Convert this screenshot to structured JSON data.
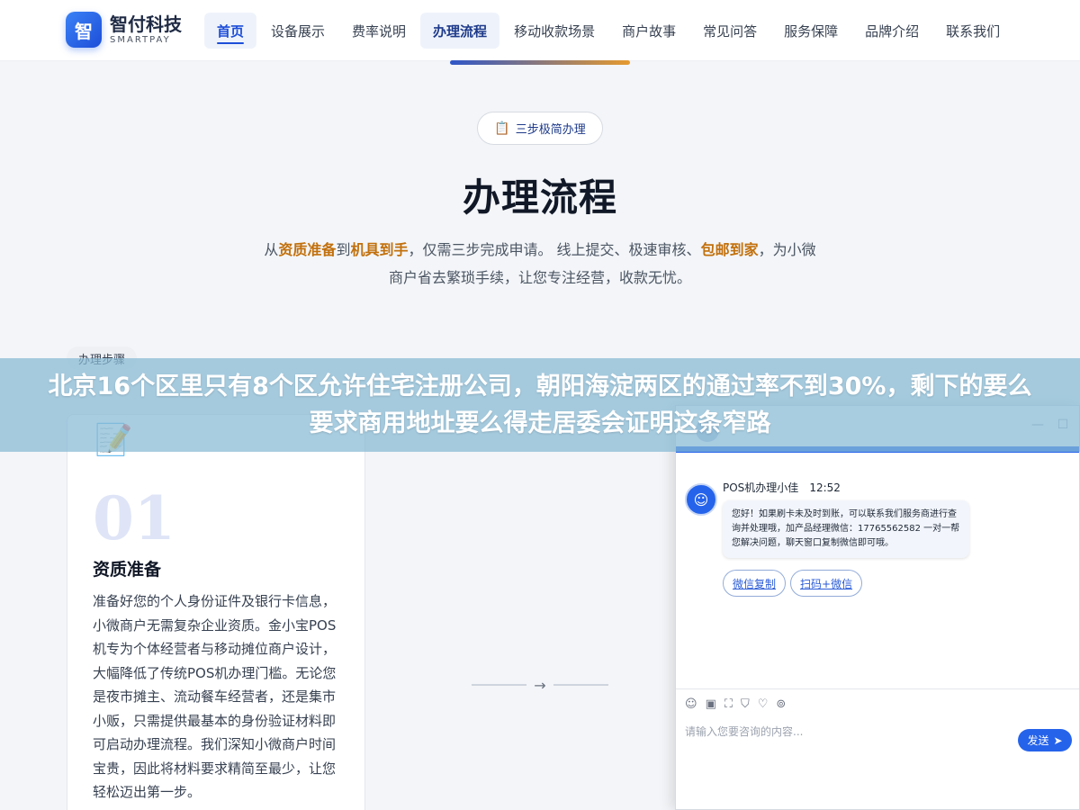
{
  "brand": {
    "mark": "智",
    "name_cn": "智付科技",
    "name_en": "SMARTPAY"
  },
  "nav": [
    {
      "label": "首页"
    },
    {
      "label": "设备展示"
    },
    {
      "label": "费率说明"
    },
    {
      "label": "办理流程"
    },
    {
      "label": "移动收款场景"
    },
    {
      "label": "商户故事"
    },
    {
      "label": "常见问答"
    },
    {
      "label": "服务保障"
    },
    {
      "label": "品牌介绍"
    },
    {
      "label": "联系我们"
    }
  ],
  "hero": {
    "badge_icon": "clipboard-icon",
    "badge": "三步极简办理",
    "title": "办理流程",
    "desc_1": "从",
    "hl_1": "资质准备",
    "desc_2": "到",
    "hl_2": "机具到手",
    "desc_3": "，仅需三步完成申请。 线上提交、极速审核、",
    "hl_3": "包邮到家",
    "desc_4": "，为小微商户省去繁琐手续，让您专注经营，收款无忧。"
  },
  "steps": {
    "tag": "办理步骤",
    "card": {
      "icon": "document-sign-icon",
      "number": "01",
      "title": "资质准备",
      "desc": "准备好您的个人身份证件及银行卡信息，小微商户无需复杂企业资质。金小宝POS机专为个体经营者与移动摊位商户设计，大幅降低了传统POS机办理门槛。无论您是夜市摊主、流动餐车经营者，还是集市小贩，只需提供最基本的身份验证材料即可启动办理流程。我们深知小微商户时间宝贵，因此将材料要求精简至最少，让您轻松迈出第一步。"
    },
    "arrow": "→"
  },
  "banner": {
    "text": "北京16个区里只有8个区允许住宅注册公司，朝阳海淀两区的通过率不到30%，剩下的要么要求商用地址要么得走居委会证明这条窄路"
  },
  "chat": {
    "win_min": "—",
    "win_max": "☐",
    "agent_name": "POS机办理小佳",
    "time": "12:52",
    "message": "您好！如果刷卡未及时到账，可以联系我们服务商进行查询并处理哦，加产品经理微信：17765562582 一对一帮您解决问题，聊天窗口复制微信即可哦。",
    "quick_replies": [
      "微信复制",
      "扫码+微信"
    ],
    "input_placeholder": "请输入您要咨询的内容...",
    "send_label": "发送",
    "colors": {
      "accent": "#2563eb"
    }
  }
}
